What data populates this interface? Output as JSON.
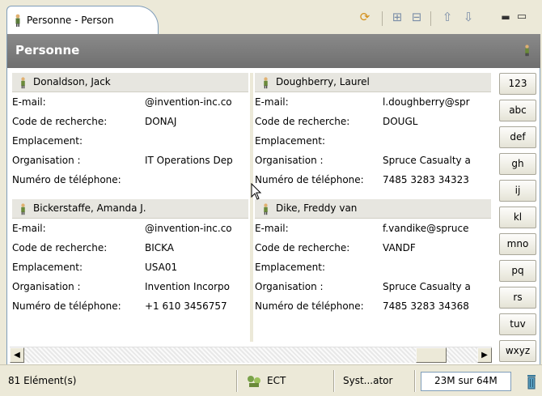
{
  "tab": {
    "label": "Personne - Person",
    "icon": "person-icon"
  },
  "toolbar": {
    "icons": [
      "sync-icon",
      "expand-all-icon",
      "collapse-all-icon",
      "up-arrow-icon",
      "down-arrow-icon",
      "minimize-icon",
      "maximize-icon"
    ]
  },
  "header": {
    "title": "Personne",
    "icon": "person-icon"
  },
  "cards": [
    {
      "name": "Donaldson, Jack",
      "fields": [
        {
          "label": "E-mail:",
          "value": "@invention-inc.co"
        },
        {
          "label": "Code de recherche:",
          "value": "DONAJ"
        },
        {
          "label": "Emplacement:",
          "value": ""
        },
        {
          "label": "Organisation  :",
          "value": "IT Operations Dep"
        },
        {
          "label": "Numéro de téléphone:",
          "value": ""
        }
      ]
    },
    {
      "name": "Doughberry, Laurel",
      "fields": [
        {
          "label": "E-mail:",
          "value": "l.doughberry@spr"
        },
        {
          "label": "Code de recherche:",
          "value": "DOUGL"
        },
        {
          "label": "Emplacement:",
          "value": ""
        },
        {
          "label": "Organisation  :",
          "value": "Spruce Casualty a"
        },
        {
          "label": "Numéro de téléphone:",
          "value": "7485 3283 34323"
        }
      ]
    },
    {
      "name": "Bickerstaffe, Amanda J.",
      "fields": [
        {
          "label": "E-mail:",
          "value": "@invention-inc.co"
        },
        {
          "label": "Code de recherche:",
          "value": "BICKA"
        },
        {
          "label": "Emplacement:",
          "value": "USA01"
        },
        {
          "label": "Organisation  :",
          "value": "Invention Incorpo"
        },
        {
          "label": "Numéro de téléphone:",
          "value": "+1 610 3456757"
        }
      ]
    },
    {
      "name": "Dike, Freddy van",
      "fields": [
        {
          "label": "E-mail:",
          "value": "f.vandike@spruce"
        },
        {
          "label": "Code de recherche:",
          "value": "VANDF"
        },
        {
          "label": "Emplacement:",
          "value": ""
        },
        {
          "label": "Organisation  :",
          "value": "Spruce Casualty a"
        },
        {
          "label": "Numéro de téléphone:",
          "value": "7485 3283 34368"
        }
      ]
    }
  ],
  "alpha_index": [
    "123",
    "abc",
    "def",
    "gh",
    "ij",
    "kl",
    "mno",
    "pq",
    "rs",
    "tuv",
    "wxyz"
  ],
  "status": {
    "count": "81 Elément(s)",
    "location": "ECT",
    "user": "Syst...ator",
    "memory": "23M sur 64M",
    "location_icon": "network-icon",
    "gc_icon": "trash-icon"
  }
}
